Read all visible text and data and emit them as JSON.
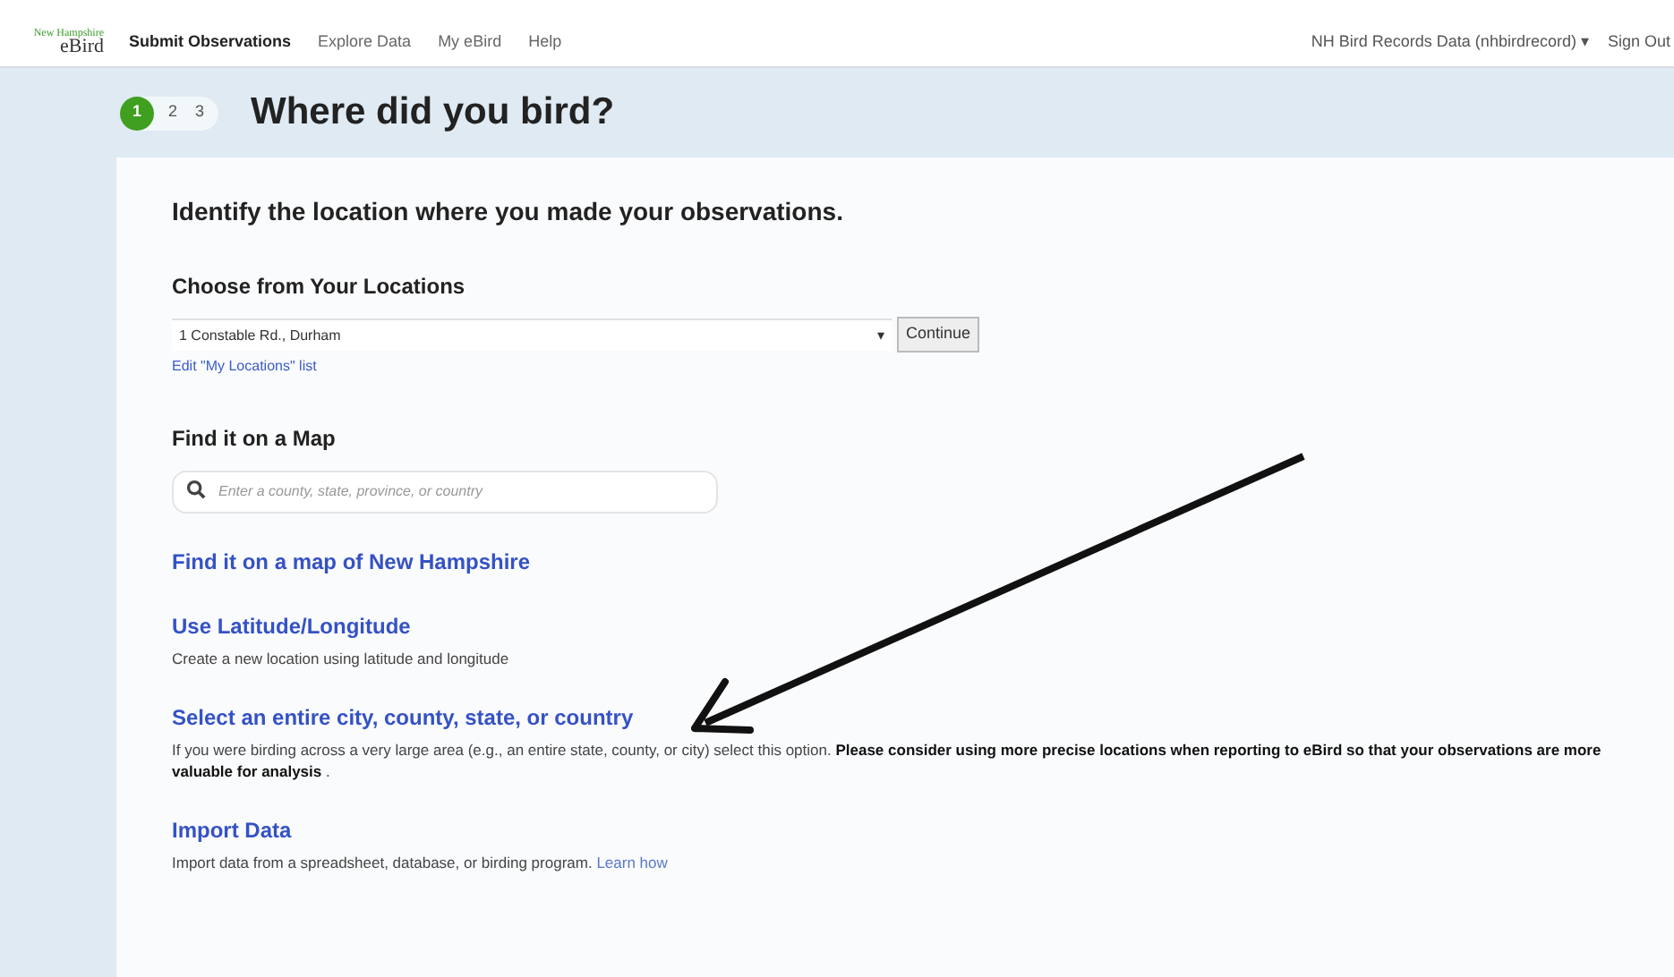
{
  "logo": {
    "top": "New Hampshire",
    "bottom": "eBird"
  },
  "nav": [
    {
      "label": "Submit Observations",
      "selected": true
    },
    {
      "label": "Explore Data",
      "selected": false
    },
    {
      "label": "My eBird",
      "selected": false
    },
    {
      "label": "Help",
      "selected": false
    }
  ],
  "account": {
    "label": "NH Bird Records Data (nhbirdrecord)",
    "caret": "▾",
    "sign_out": "Sign Out"
  },
  "steps": [
    {
      "label": "1",
      "selected": true
    },
    {
      "label": "2",
      "selected": false
    },
    {
      "label": "3",
      "selected": false
    }
  ],
  "title": "Where did you bird?",
  "intro": "Identify the location where you made your observations.",
  "locations": {
    "heading": "Choose from Your Locations",
    "value": "1 Constable Rd., Durham",
    "button": "Continue",
    "edit_link": "Edit \"My Locations\" list"
  },
  "map": {
    "heading": "Find it on a Map",
    "placeholder": "Enter a county, state, province, or country"
  },
  "options": [
    {
      "link": "Find it on a map of New Hampshire"
    },
    {
      "link": "Use Latitude/Longitude",
      "description": "Create a new location using latitude and longitude"
    },
    {
      "link": "Select an entire city, county, state, or country",
      "description": "If you were birding across a very large area (e.g., an entire state, county, or city) select this option. **Please consider using more precise locations when reporting to eBird so that your observations are more valuable for analysis** ."
    },
    {
      "link": "Import Data",
      "description": "Import data from a spreadsheet, database, or birding program.",
      "extra_link": "Learn how"
    }
  ]
}
